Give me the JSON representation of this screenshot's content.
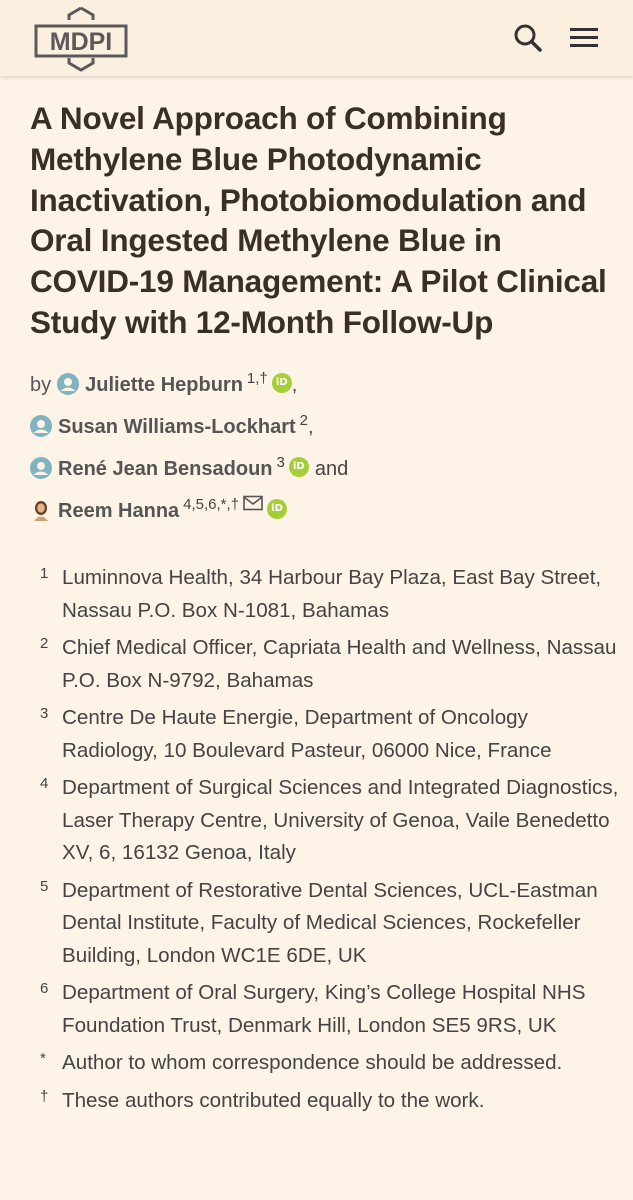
{
  "header": {
    "logo_text": "MDPI",
    "search_icon": "search-icon",
    "menu_icon": "hamburger-menu-icon"
  },
  "article": {
    "title": "A Novel Approach of Combining Methylene Blue Photodynamic Inactivation, Photobiomodulation and Oral Ingested Methylene Blue in COVID-19 Management: A Pilot Clinical Study with 12-Month Follow-Up",
    "by": "by",
    "and": "and",
    "authors": [
      {
        "name": "Juliette Hepburn",
        "sup": "1,†",
        "orcid": true,
        "suffix": ","
      },
      {
        "name": "Susan Williams-Lockhart",
        "sup": "2",
        "orcid": false,
        "suffix": ","
      },
      {
        "name": "René Jean Bensadoun",
        "sup": "3",
        "orcid": true,
        "suffix": ""
      },
      {
        "name": "Reem Hanna",
        "sup": "4,5,6,*,†",
        "orcid": true,
        "email": true,
        "suffix": ""
      }
    ],
    "orcid_label": "iD"
  },
  "affiliations": [
    {
      "marker": "1",
      "text": "Luminnova Health, 34 Harbour Bay Plaza, East Bay Street, Nassau P.O. Box N-1081, Bahamas"
    },
    {
      "marker": "2",
      "text": "Chief Medical Officer, Capriata Health and Wellness, Nassau P.O. Box N-9792, Bahamas"
    },
    {
      "marker": "3",
      "text": "Centre De Haute Energie, Department of Oncology Radiology, 10 Boulevard Pasteur, 06000 Nice, France"
    },
    {
      "marker": "4",
      "text": "Department of Surgical Sciences and Integrated Diagnostics, Laser Therapy Centre, University of Genoa, Vaile Benedetto XV, 6, 16132 Genoa, Italy"
    },
    {
      "marker": "5",
      "text": "Department of Restorative Dental Sciences, UCL-Eastman Dental Institute, Faculty of Medical Sciences, Rockefeller Building, London WC1E 6DE, UK"
    },
    {
      "marker": "6",
      "text": "Department of Oral Surgery, King’s College Hospital NHS Foundation Trust, Denmark Hill, London SE5 9RS, UK"
    },
    {
      "marker": "*",
      "text": "Author to whom correspondence should be addressed."
    },
    {
      "marker": "†",
      "text": "These authors contributed equally to the work."
    }
  ],
  "colors": {
    "background": "#fdf3e7",
    "header_bg": "#fbefe0",
    "title": "#3a2e27",
    "orcid_green": "#a6ce39",
    "avatar_teal": "#7fb3bf"
  }
}
